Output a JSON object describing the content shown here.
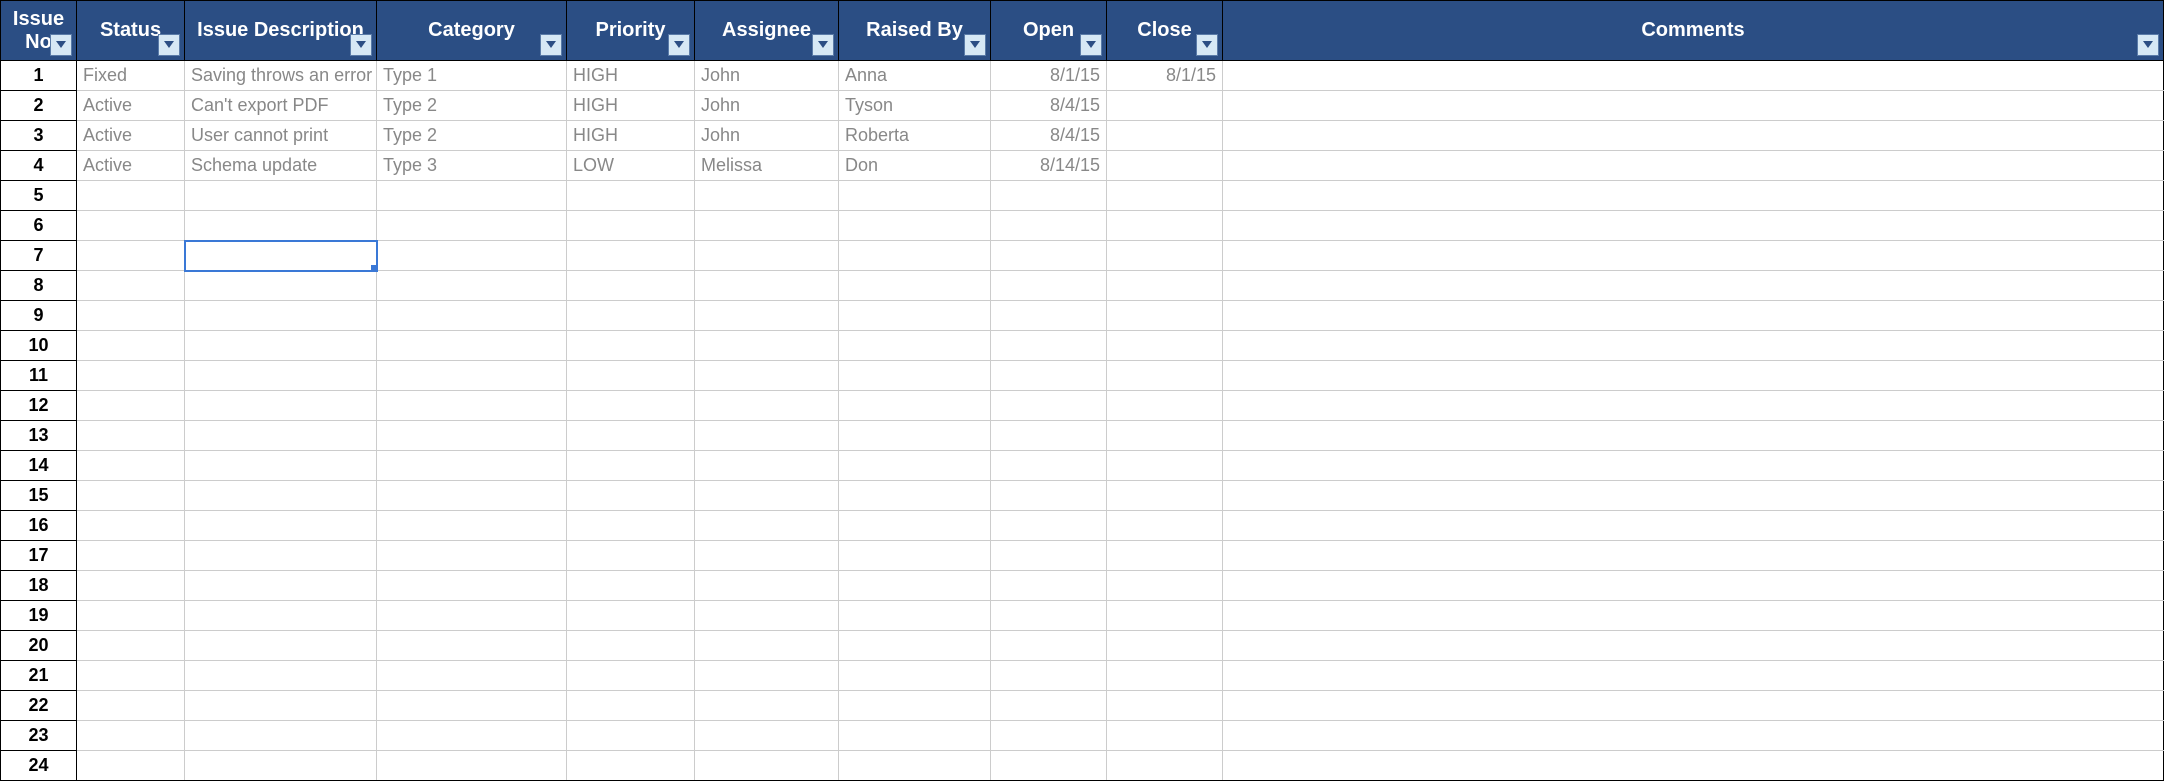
{
  "columns": [
    {
      "key": "issue_no",
      "label": "Issue No"
    },
    {
      "key": "status",
      "label": "Status"
    },
    {
      "key": "description",
      "label": "Issue Description"
    },
    {
      "key": "category",
      "label": "Category"
    },
    {
      "key": "priority",
      "label": "Priority"
    },
    {
      "key": "assignee",
      "label": "Assignee"
    },
    {
      "key": "raised_by",
      "label": "Raised By"
    },
    {
      "key": "open",
      "label": "Open"
    },
    {
      "key": "close",
      "label": "Close"
    },
    {
      "key": "comments",
      "label": "Comments"
    }
  ],
  "total_rows": 24,
  "rows": [
    {
      "issue_no": "1",
      "status": "Fixed",
      "description": "Saving throws an error",
      "category": "Type 1",
      "priority": "HIGH",
      "assignee": "John",
      "raised_by": "Anna",
      "open": "8/1/15",
      "close": "8/1/15",
      "comments": ""
    },
    {
      "issue_no": "2",
      "status": "Active",
      "description": "Can't export PDF",
      "category": "Type 2",
      "priority": "HIGH",
      "assignee": "John",
      "raised_by": "Tyson",
      "open": "8/4/15",
      "close": "",
      "comments": ""
    },
    {
      "issue_no": "3",
      "status": "Active",
      "description": "User cannot print",
      "category": "Type 2",
      "priority": "HIGH",
      "assignee": "John",
      "raised_by": "Roberta",
      "open": "8/4/15",
      "close": "",
      "comments": ""
    },
    {
      "issue_no": "4",
      "status": "Active",
      "description": "Schema update",
      "category": "Type 3",
      "priority": "LOW",
      "assignee": "Melissa",
      "raised_by": "Don",
      "open": "8/14/15",
      "close": "",
      "comments": ""
    }
  ],
  "selected_cell": {
    "row_index": 6,
    "col_key": "description"
  }
}
